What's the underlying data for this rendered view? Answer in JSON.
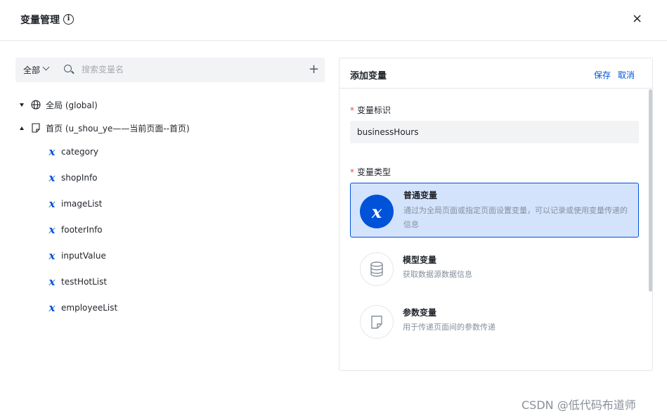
{
  "dialog": {
    "title": "变量管理",
    "info_glyph": "i",
    "close_glyph": "×"
  },
  "toolbar": {
    "scope_label": "全部",
    "search_placeholder": "搜索变量名",
    "add_glyph": "+"
  },
  "tree": {
    "global_label": "全局 (global)",
    "page_label": "首页 (u_shou_ye——当前页面--首页)",
    "variables": [
      "category",
      "shopInfo",
      "imageList",
      "footerInfo",
      "inputValue",
      "testHotList",
      "employeeList"
    ],
    "var_glyph": "x"
  },
  "panel": {
    "title": "添加变量",
    "save_label": "保存",
    "cancel_label": "取消",
    "id_label": "变量标识",
    "required_mark": "*",
    "id_value": "businessHours",
    "type_label": "变量类型",
    "types": [
      {
        "name": "普通变量",
        "desc": "通过为全局页面或指定页面设置变量，可以记录或使用变量传递的信息",
        "icon": "variable-x-icon",
        "selected": true
      },
      {
        "name": "模型变量",
        "desc": "获取数据源数据信息",
        "icon": "database-icon",
        "selected": false
      },
      {
        "name": "参数变量",
        "desc": "用于传递页面间的参数传递",
        "icon": "document-icon",
        "selected": false
      }
    ]
  },
  "watermark": "CSDN @低代码布道师",
  "colors": {
    "accent": "#0052d9",
    "selected_bg": "#d4e3fc",
    "required": "#e34d59"
  }
}
